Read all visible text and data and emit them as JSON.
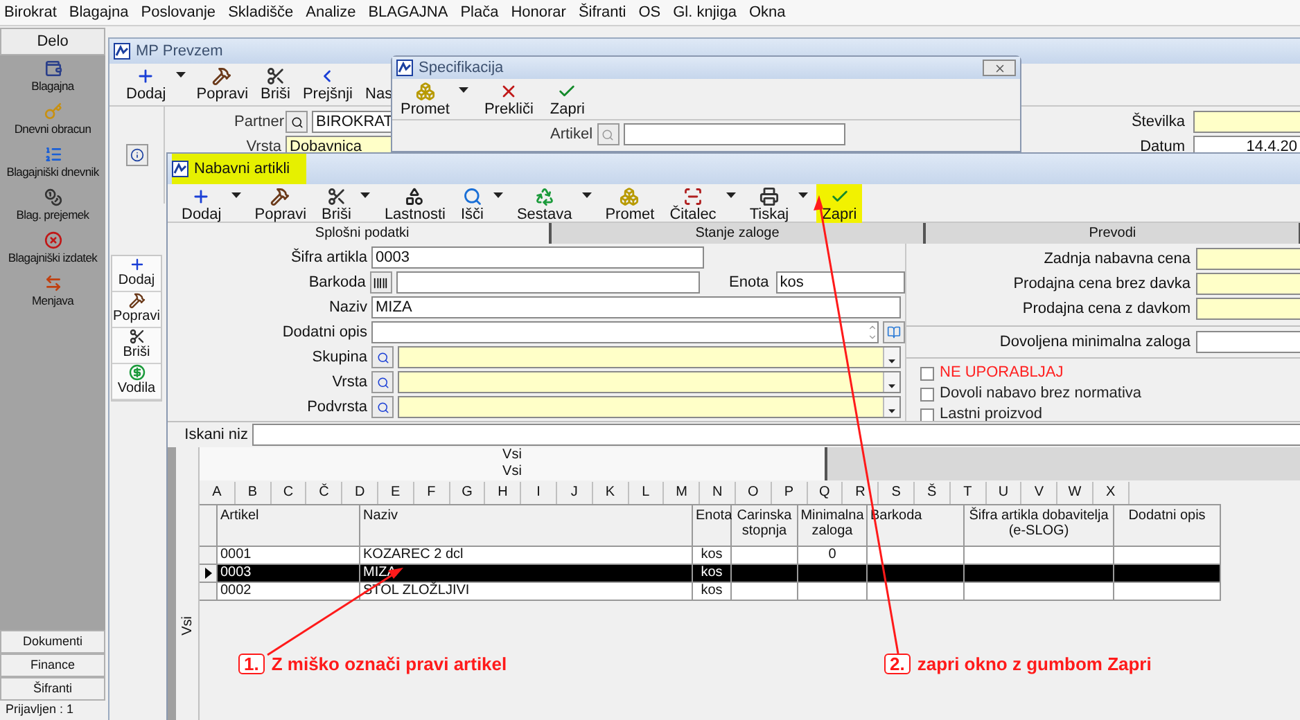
{
  "menu": [
    "Birokrat",
    "Blagajna",
    "Poslovanje",
    "Skladišče",
    "Analize",
    "BLAGAJNA",
    "Plača",
    "Honorar",
    "Šifranti",
    "OS",
    "Gl. knjiga",
    "Okna"
  ],
  "sidebar": {
    "header": "Delo",
    "items": [
      {
        "label": "Blagajna",
        "kind": "cash"
      },
      {
        "label": "Dnevni obracun",
        "kind": "key"
      },
      {
        "label": "Blagajniški dnevnik",
        "kind": "journal"
      },
      {
        "label": "Blag. prejemek",
        "kind": "receipt"
      },
      {
        "label": "Blagajniški izdatek",
        "kind": "expense"
      },
      {
        "label": "Menjava",
        "kind": "exchange"
      }
    ],
    "bottom_tabs": [
      "Dokumenti",
      "Finance",
      "Šifranti"
    ],
    "status": "Prijavljen : 1"
  },
  "mp_prevzem": {
    "title": "MP Prevzem",
    "toolbar": [
      {
        "label": "Dodaj",
        "kind": "add",
        "dropdown": true
      },
      {
        "label": "Popravi",
        "kind": "edit",
        "dropdown": false
      },
      {
        "label": "Briši",
        "kind": "delete",
        "dropdown": false
      },
      {
        "label": "Prejšnji",
        "kind": "previous",
        "dropdown": false
      },
      {
        "label": "Nas",
        "kind": "partial",
        "dropdown": false
      }
    ],
    "partner": {
      "label": "Partner",
      "value": "BIROKRAT"
    },
    "vrsta": {
      "label": "Vrsta",
      "value": "Dobavnica"
    },
    "stevilka": {
      "label": "Številka"
    },
    "datum": {
      "label": "Datum",
      "value": "14.4.20"
    },
    "side_toolbar": [
      {
        "label": "Dodaj",
        "kind": "add"
      },
      {
        "label": "Popravi",
        "kind": "edit"
      },
      {
        "label": "Briši",
        "kind": "delete"
      },
      {
        "label": "Vodila",
        "kind": "money"
      }
    ]
  },
  "specifikacija": {
    "title": "Specifikacija",
    "toolbar": [
      {
        "label": "Promet",
        "kind": "turnover",
        "dropdown": true
      },
      {
        "label": "Prekliči",
        "kind": "cancel",
        "dropdown": false
      },
      {
        "label": "Zapri",
        "kind": "close",
        "dropdown": false
      }
    ],
    "artikel": {
      "label": "Artikel"
    }
  },
  "nabavni_artikli": {
    "title": "Nabavni artikli",
    "title_highlighted": true,
    "toolbar": [
      {
        "label": "Dodaj",
        "kind": "add",
        "dropdown": true,
        "highlighted": false
      },
      {
        "label": "Popravi",
        "kind": "edit",
        "dropdown": false,
        "highlighted": false
      },
      {
        "label": "Briši",
        "kind": "delete",
        "dropdown": true,
        "highlighted": false
      },
      {
        "label": "Lastnosti",
        "kind": "properties",
        "dropdown": false,
        "highlighted": false
      },
      {
        "label": "Išči",
        "kind": "search",
        "dropdown": true,
        "highlighted": false
      },
      {
        "label": "Sestava",
        "kind": "assembly",
        "dropdown": true,
        "highlighted": false
      },
      {
        "label": "Promet",
        "kind": "turnover",
        "dropdown": false,
        "highlighted": false
      },
      {
        "label": "Čitalec",
        "kind": "reader",
        "dropdown": true,
        "highlighted": false
      },
      {
        "label": "Tiskaj",
        "kind": "print",
        "dropdown": true,
        "highlighted": false
      },
      {
        "label": "Zapri",
        "kind": "close",
        "dropdown": false,
        "highlighted": true
      }
    ],
    "tabs": [
      {
        "label": "Splošni podatki",
        "selected": true
      },
      {
        "label": "Stanje zaloge",
        "selected": false
      },
      {
        "label": "Prevodi",
        "selected": false
      }
    ],
    "sifra": {
      "label": "Šifra artikla",
      "value": "0003"
    },
    "barkoda": {
      "label": "Barkoda"
    },
    "enota": {
      "label": "Enota",
      "value": "kos"
    },
    "naziv": {
      "label": "Naziv",
      "value": "MIZA"
    },
    "dodatni_opis": {
      "label": "Dodatni opis"
    },
    "combos": [
      {
        "label": "Skupina"
      },
      {
        "label": "Vrsta"
      },
      {
        "label": "Podvrsta"
      }
    ],
    "prices": [
      {
        "label": "Zadnja nabavna cena"
      },
      {
        "label": "Prodajna cena brez davka"
      },
      {
        "label": "Prodajna cena z davkom"
      }
    ],
    "min_zaloga": {
      "label": "Dovoljena minimalna zaloga"
    },
    "checkboxes": [
      {
        "label": "NE UPORABLJAJ",
        "checked": false,
        "warning": true
      },
      {
        "label": "Dovoli nabavo brez normativa",
        "checked": false,
        "warning": false
      },
      {
        "label": "Lastni proizvod",
        "checked": false,
        "warning": false
      }
    ],
    "search": {
      "label": "Iskani niz"
    },
    "filters": [
      "Vsi",
      "Vsi"
    ],
    "letters": [
      "A",
      "B",
      "C",
      "Č",
      "D",
      "E",
      "F",
      "G",
      "H",
      "I",
      "J",
      "K",
      "L",
      "M",
      "N",
      "O",
      "P",
      "Q",
      "R",
      "S",
      "Š",
      "T",
      "U",
      "V",
      "W",
      "X"
    ],
    "side_filter": "Vsi",
    "table": {
      "columns": [
        "Artikel",
        "Naziv",
        "Enota",
        "Carinska stopnja",
        "Minimalna zaloga",
        "Barkoda",
        "Šifra artikla dobavitelja (e-SLOG)",
        "Dodatni opis"
      ],
      "rows": [
        {
          "cells": [
            "0001",
            "KOZAREC 2 dcl",
            "kos",
            "",
            "0",
            "",
            "",
            ""
          ],
          "selected": false
        },
        {
          "cells": [
            "0003",
            "MIZA",
            "kos",
            "",
            "",
            "",
            "",
            ""
          ],
          "selected": true
        },
        {
          "cells": [
            "0002",
            "STOL ZLOŽLJIVI",
            "kos",
            "",
            "",
            "",
            "",
            ""
          ],
          "selected": false
        }
      ]
    }
  },
  "annotations": [
    {
      "number": "1.",
      "text": "Z miško označi pravi artikel"
    },
    {
      "number": "2.",
      "text": "zapri okno z gumbom Zapri"
    }
  ]
}
